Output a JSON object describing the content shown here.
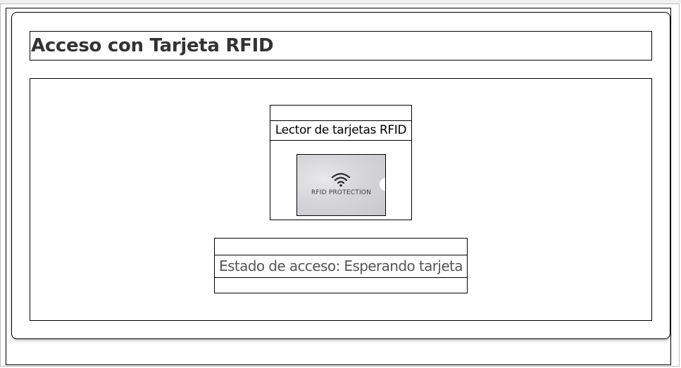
{
  "header": {
    "title": "Acceso con Tarjeta RFID"
  },
  "reader": {
    "title": "Lector de tarjetas RFID",
    "card_image": {
      "label": "RFID PROTECTION",
      "icon": "wifi-icon"
    }
  },
  "status": {
    "text": "Estado de acceso: Esperando tarjeta"
  },
  "colors": {
    "title_text": "#333333",
    "status_text": "#555555",
    "border": "#000000"
  }
}
